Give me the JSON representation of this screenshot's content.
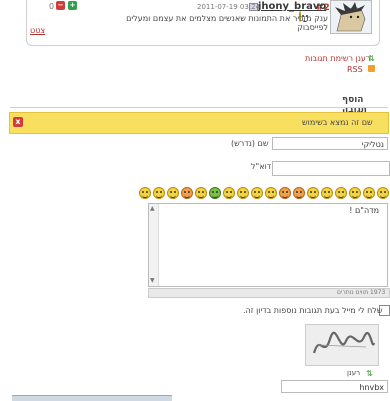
{
  "comment": {
    "number": "#2",
    "author": "jhony_bravo",
    "date": "2011-07-19 03:24",
    "vote_count": "0",
    "vote_up_label": "+",
    "vote_down_label": "−",
    "text": "ענק מזכיר את התמונות שאנשים מצלמים את עצמם ומעלים לפייסבוק",
    "quote_link": "צטט"
  },
  "links": {
    "refresh_comments": "רענן רשימת תגובות",
    "rss": "RSS"
  },
  "form": {
    "heading": "הוסף תגובה",
    "error_message": "שם זה נמצא בשימוש",
    "error_icon": "x",
    "name_value": "נטליקי",
    "name_label": "שם (נדרש)",
    "email_label": "דוא\"ל",
    "email_value": "",
    "textarea_value": "מדה\"ם !",
    "char_counter": "1973 תווים נותרים",
    "notify_label": "שלח לי מייל בעת תגובות נוספות בדיון זה.",
    "captcha_refresh_label": "רענן",
    "captcha_value": "hnvbx"
  },
  "smileys": [
    "smile",
    "grin",
    "wink",
    "cool",
    "tongue",
    "laugh",
    "sad",
    "shock",
    "angry",
    "confused",
    "neutral",
    "blush",
    "green-sick",
    "kiss",
    "evil",
    "sleep",
    "cry",
    "roll",
    "rolleyes",
    "happy"
  ],
  "colors": {
    "link": "#b23030",
    "error_bg": "#f9df60",
    "vote_up": "#2fa04a",
    "vote_down": "#d23b3b"
  }
}
